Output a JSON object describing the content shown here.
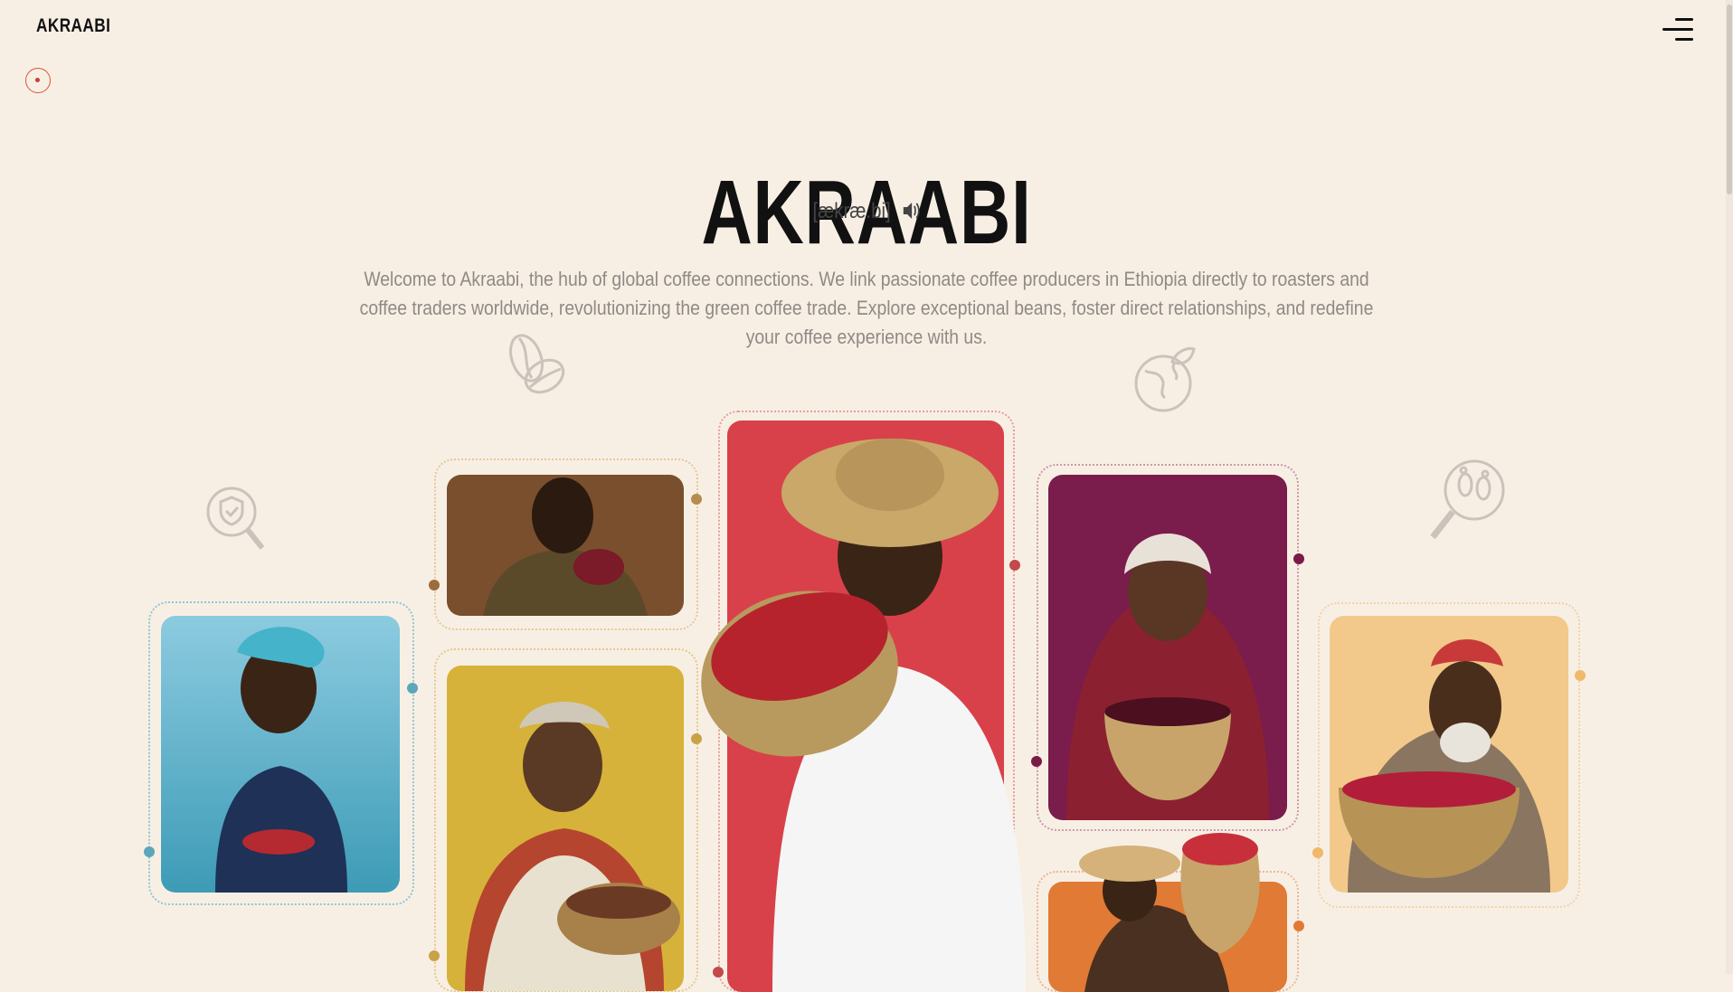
{
  "header": {
    "brand": "AKRAABI",
    "menu_icon": "hamburger-icon"
  },
  "hero": {
    "title": "AKRAABI",
    "phonetic": "[ækræ.bi]",
    "description": "Welcome to Akraabi, the hub of global coffee connections. We link passionate coffee producers in Ethiopia directly to roasters and coffee traders worldwide, revolutionizing the green coffee trade. Explore exceptional beans, foster direct relationships, and redefine your coffee experience with us."
  },
  "colors": {
    "background": "#f8efe4",
    "accent_red": "#d23a2a",
    "teal": "#5ba7bb",
    "gold": "#c9a248",
    "maroon": "#7a1a47",
    "orange": "#e07a35"
  },
  "gallery": {
    "decorative_icons": [
      "shield-search-icon",
      "coffee-beans-icon",
      "globe-leaf-icon",
      "footprint-search-icon"
    ],
    "cards": [
      {
        "name": "farmer-teal-card",
        "bg": "#5fb0c6"
      },
      {
        "name": "farmer-brown-card",
        "bg": "#7a4f2e"
      },
      {
        "name": "farmer-gold-card",
        "bg": "#d7b23a"
      },
      {
        "name": "farmer-red-card",
        "bg": "#d8414a"
      },
      {
        "name": "farmer-maroon-card",
        "bg": "#7a1c4c"
      },
      {
        "name": "farmer-orange-card",
        "bg": "#e07a35"
      },
      {
        "name": "farmer-peach-card",
        "bg": "#f2c98a"
      }
    ]
  }
}
